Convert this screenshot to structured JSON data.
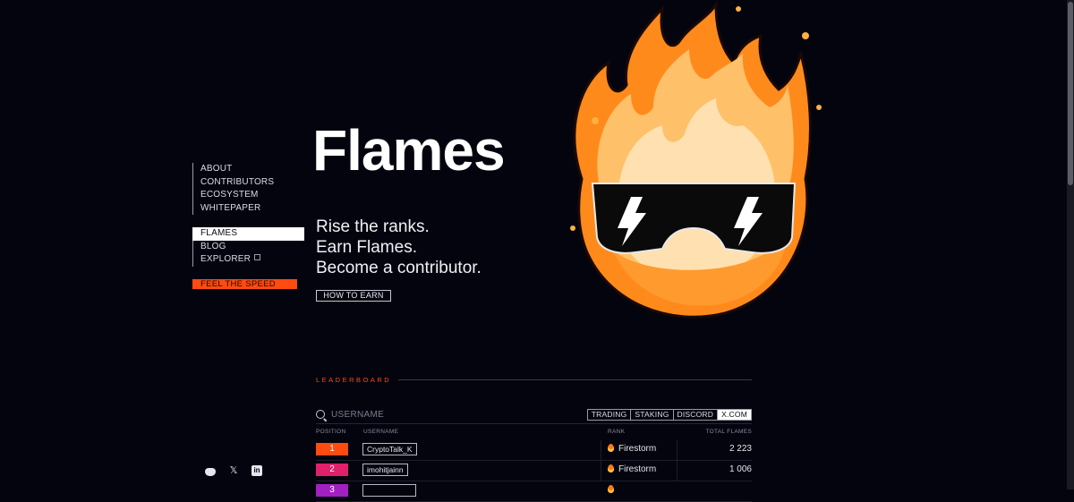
{
  "nav": {
    "group1": [
      "ABOUT",
      "CONTRIBUTORS",
      "ECOSYSTEM",
      "WHITEPAPER"
    ],
    "group2": [
      "FLAMES",
      "BLOG",
      "EXPLORER"
    ],
    "active": "FLAMES",
    "cta": "FEEL THE SPEED"
  },
  "hero": {
    "title": "Flames",
    "tagline": [
      "Rise the ranks.",
      "Earn Flames.",
      "Become a contributor."
    ],
    "cta": "HOW TO EARN"
  },
  "leaderboard": {
    "label": "LEADERBOARD",
    "search_placeholder": "USERNAME",
    "filters": [
      "TRADING",
      "STAKING",
      "DISCORD",
      "X.COM"
    ],
    "active_filter": "X.COM",
    "columns": {
      "position": "POSITION",
      "username": "USERNAME",
      "rank": "RANK",
      "total": "TOTAL FLAMES"
    },
    "rows": [
      {
        "position": "1",
        "username": "CryptoTalk_K",
        "rank": "Firestorm",
        "total": "2 223",
        "color": "#ff4a10"
      },
      {
        "position": "2",
        "username": "imohitjainn",
        "rank": "Firestorm",
        "total": "1 006",
        "color": "#e0206a"
      },
      {
        "position": "3",
        "username": "",
        "rank": "",
        "total": "",
        "color": "#a020c0"
      }
    ]
  },
  "colors": {
    "accent": "#ff4a10",
    "background": "#04040f"
  },
  "socials": [
    "discord-icon",
    "x-icon",
    "linkedin-icon"
  ]
}
